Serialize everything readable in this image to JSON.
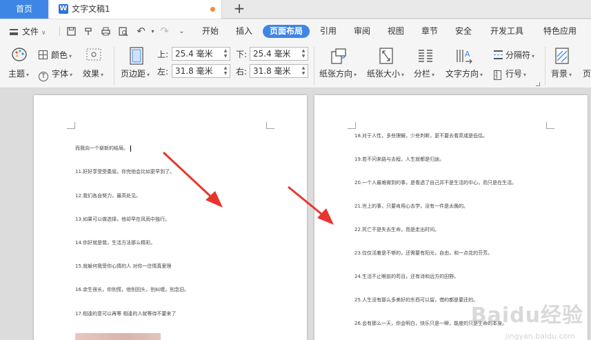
{
  "tabs": {
    "home": "首页",
    "doc_title": "文字文稿1",
    "new_tab": "+"
  },
  "menu": {
    "file": "文件",
    "items": [
      "开始",
      "插入",
      "页面布局",
      "引用",
      "审阅",
      "视图",
      "章节",
      "安全",
      "开发工具",
      "特色应用"
    ],
    "active": "页面布局"
  },
  "ribbon": {
    "theme": "主题",
    "color": "颜色",
    "font": "字体",
    "effect": "效果",
    "margin": "页边距",
    "top_label": "上:",
    "top_value": "25.4 毫米",
    "bottom_label": "下:",
    "bottom_value": "25.4 毫米",
    "left_label": "左:",
    "left_value": "31.8 毫米",
    "right_label": "右:",
    "right_value": "31.8 毫米",
    "orientation": "纸张方向",
    "size": "纸张大小",
    "columns": "分栏",
    "text_direction": "文字方向",
    "breaks": "分隔符",
    "line_numbers": "行号",
    "background": "背景",
    "page_border": "页"
  },
  "page1_lines": [
    "而我向一个崭新的结局。",
    "11.好好享受受委屈，你完他会比如更早到了。",
    "12.我们各自努力，最高处见。",
    "13.如果可以做选择，他却早在风雨中独行。",
    "14.你好就是我，生活方法那么精彩。",
    "15.就躲何我受你心情的人 对你一往情真爱理",
    "16.余生很长，你别慌，他别回头，别纠缠，别念旧。",
    "17.相逢的意可以再等 相逢的人就等待不要来了"
  ],
  "page2_lines": [
    "18.对于人性，多些理解，少些判断，更不要去看高或是低估。",
    "19.若不问来路与去程，人生就都是归途。",
    "20.一个人最难做到的事，是看透了自己并不是生活的中心，而只是在生活。",
    "21.世上的事，只要肯用心去学，没有一件是太晚的。",
    "22.死亡不是失去生命，而是走出时间。",
    "23.仅仅活着是不够的，还需要有阳光，自由，和一点花的芬芳。",
    "24.生活不止眼前的苟且，还有诗和远方的田野。",
    "25.人生没有那么多美好的东西可以留，借的都是要还的。",
    "26.会有那么一天，你会明白，快乐只是一瞬，能度的只是生命的本身。"
  ],
  "watermark": "Baidu经验",
  "watermark_sub": "jingyan.baidu.com",
  "colors": {
    "accent": "#3d86e6",
    "arrow": "#e8352b",
    "modified_dot": "#f08c3e"
  }
}
